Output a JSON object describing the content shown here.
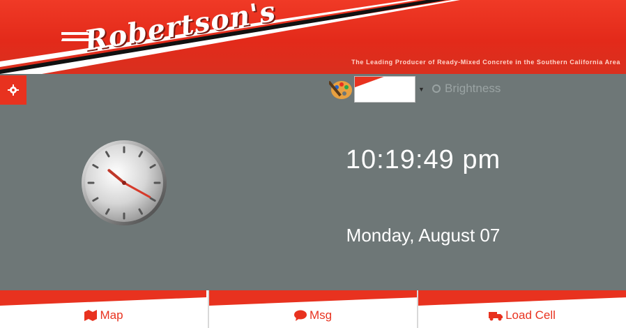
{
  "header": {
    "logo_text": "Robertson's",
    "tagline": "The Leading Producer of Ready-Mixed Concrete in the Southern California Area"
  },
  "toolbar": {
    "settings_icon": "gear-icon",
    "theme_icon": "palette-icon",
    "theme_selected": "",
    "brightness_label": "Brightness",
    "brightness_icon": "ring-icon"
  },
  "clock": {
    "time": "10:19:49 pm",
    "date": "Monday, August 07"
  },
  "nav": {
    "items": [
      {
        "label": "Map",
        "icon": "map-icon"
      },
      {
        "label": "Msg",
        "icon": "chat-bubble-icon"
      },
      {
        "label": "Load Cell",
        "icon": "truck-icon"
      }
    ]
  },
  "colors": {
    "brand_red": "#e8321f",
    "background": "#6e7777",
    "nav_background": "#ffffff"
  }
}
